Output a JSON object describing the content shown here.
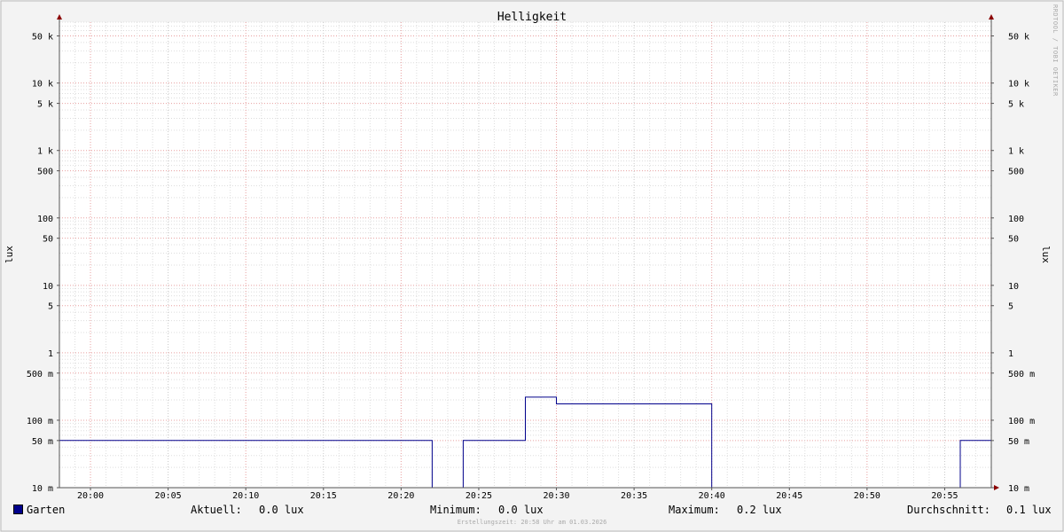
{
  "chart_data": {
    "type": "line",
    "title": "Helligkeit",
    "ylabel": "lux",
    "yscale": "log",
    "ylim": [
      0.01,
      80000
    ],
    "xlim": [
      "19:58",
      "20:58"
    ],
    "x_ticks": [
      "20:00",
      "20:05",
      "20:10",
      "20:15",
      "20:20",
      "20:25",
      "20:30",
      "20:35",
      "20:40",
      "20:45",
      "20:50",
      "20:55"
    ],
    "y_ticks": [
      {
        "value": 50000,
        "label": "50 k"
      },
      {
        "value": 10000,
        "label": "10 k"
      },
      {
        "value": 5000,
        "label": "5 k"
      },
      {
        "value": 1000,
        "label": "1 k"
      },
      {
        "value": 500,
        "label": "500"
      },
      {
        "value": 100,
        "label": "100"
      },
      {
        "value": 50,
        "label": "50"
      },
      {
        "value": 10,
        "label": "10"
      },
      {
        "value": 5,
        "label": "5"
      },
      {
        "value": 1,
        "label": "1"
      },
      {
        "value": 0.5,
        "label": "500 m"
      },
      {
        "value": 0.1,
        "label": "100 m"
      },
      {
        "value": 0.05,
        "label": "50 m"
      },
      {
        "value": 0.01,
        "label": "10 m"
      }
    ],
    "grid": true,
    "series": [
      {
        "name": "Garten",
        "color": "#00008b",
        "points": [
          {
            "x": "19:58",
            "y": 0.05
          },
          {
            "x": "20:22",
            "y": 0.05
          },
          {
            "x": "20:22",
            "y": 0.01
          },
          {
            "x": "20:24",
            "y": 0.01
          },
          {
            "x": "20:24",
            "y": 0.05
          },
          {
            "x": "20:28",
            "y": 0.05
          },
          {
            "x": "20:28",
            "y": 0.22
          },
          {
            "x": "20:30",
            "y": 0.22
          },
          {
            "x": "20:30",
            "y": 0.175
          },
          {
            "x": "20:40",
            "y": 0.175
          },
          {
            "x": "20:40",
            "y": 0.01
          },
          {
            "x": "20:56",
            "y": 0.01
          },
          {
            "x": "20:56",
            "y": 0.05
          },
          {
            "x": "20:58",
            "y": 0.05
          }
        ]
      }
    ]
  },
  "watermark": "RRDTOOL / TOBI OETIKER",
  "legend": {
    "series_name": "Garten",
    "current_label": "Aktuell:",
    "current_value": "0.0 lux",
    "min_label": "Minimum:",
    "min_value": "0.0 lux",
    "max_label": "Maximum:",
    "max_value": "0.2 lux",
    "avg_label": "Durchschnitt:",
    "avg_value": "0.1 lux"
  },
  "footer": "Erstellungszeit: 20:58 Uhr am 01.03.2026",
  "colors": {
    "background": "#f3f3f3",
    "plot_background": "#ffffff",
    "line": "#00008b",
    "major_grid": "#e8a0a0",
    "minor_grid": "#dddddd",
    "axis_arrow": "#8b0000"
  }
}
